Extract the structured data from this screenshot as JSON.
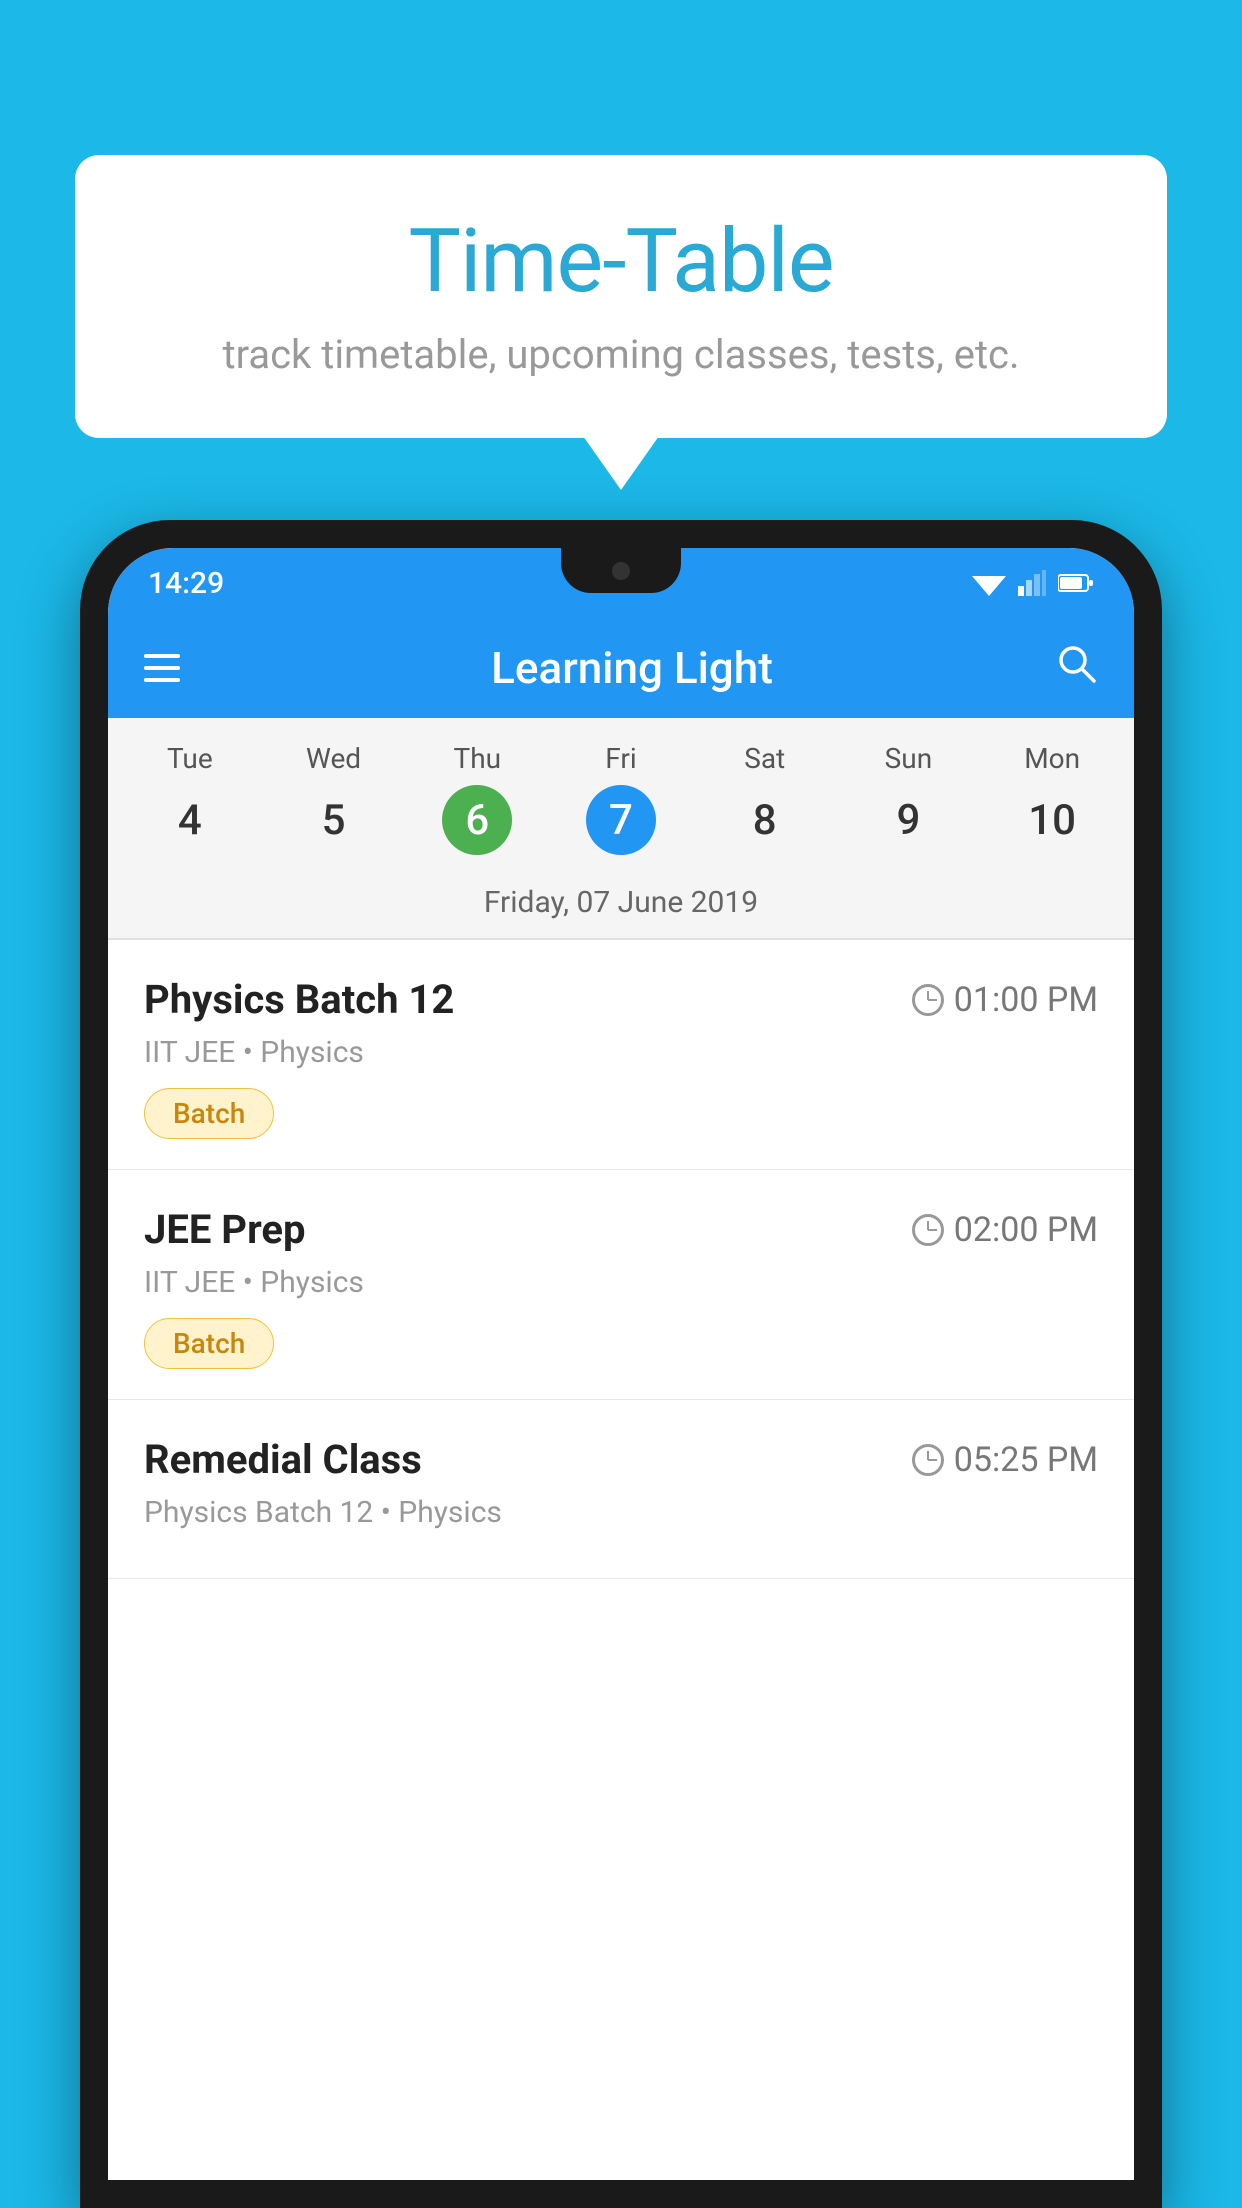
{
  "background_color": "#1BB8E8",
  "speech_bubble": {
    "title": "Time-Table",
    "subtitle": "track timetable, upcoming classes, tests, etc."
  },
  "phone": {
    "status_bar": {
      "time": "14:29"
    },
    "app_bar": {
      "title": "Learning Light"
    },
    "calendar": {
      "days": [
        {
          "label": "Tue",
          "num": "4"
        },
        {
          "label": "Wed",
          "num": "5"
        },
        {
          "label": "Thu",
          "num": "6",
          "state": "today"
        },
        {
          "label": "Fri",
          "num": "7",
          "state": "selected"
        },
        {
          "label": "Sat",
          "num": "8"
        },
        {
          "label": "Sun",
          "num": "9"
        },
        {
          "label": "Mon",
          "num": "10"
        }
      ],
      "selected_date_label": "Friday, 07 June 2019"
    },
    "schedule": [
      {
        "title": "Physics Batch 12",
        "time": "01:00 PM",
        "meta": "IIT JEE • Physics",
        "badge": "Batch"
      },
      {
        "title": "JEE Prep",
        "time": "02:00 PM",
        "meta": "IIT JEE • Physics",
        "badge": "Batch"
      },
      {
        "title": "Remedial Class",
        "time": "05:25 PM",
        "meta": "Physics Batch 12 • Physics",
        "badge": ""
      }
    ]
  }
}
